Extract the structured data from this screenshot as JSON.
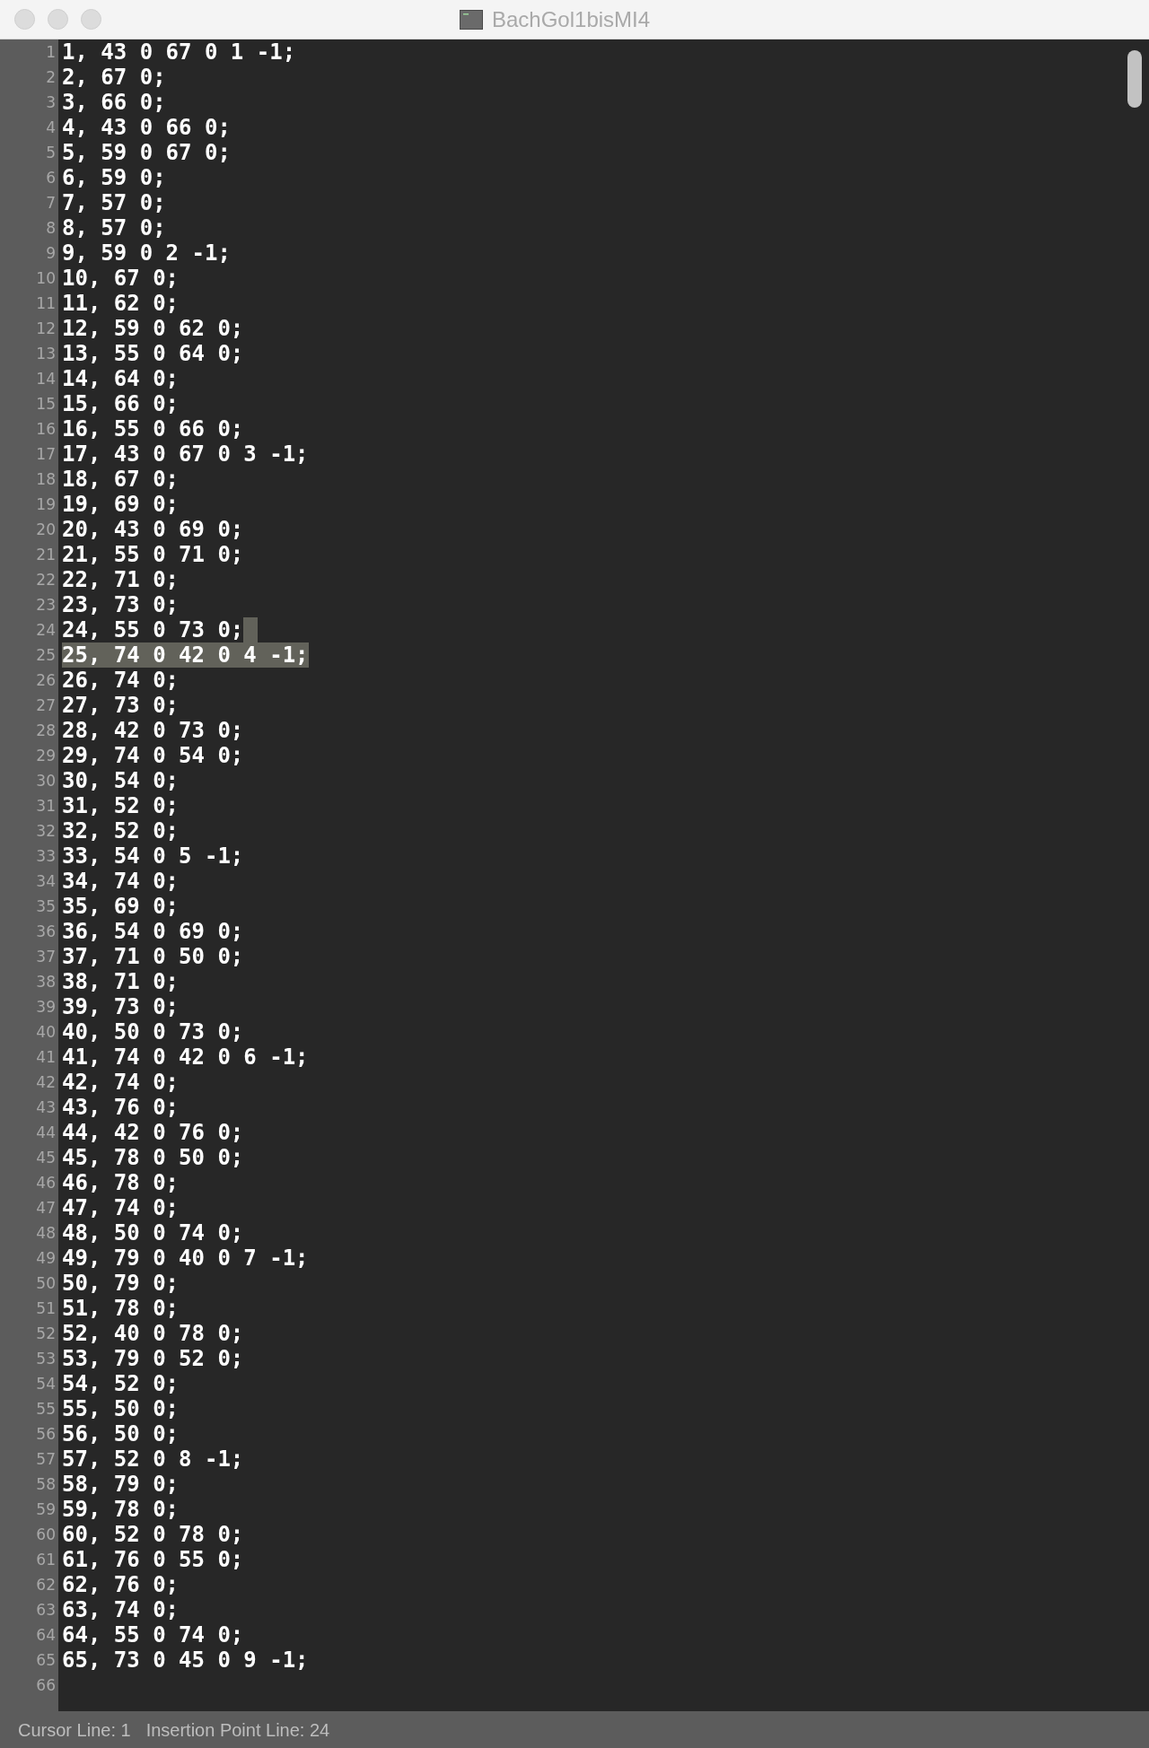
{
  "window": {
    "title": "BachGol1bisMI4"
  },
  "lines": [
    {
      "number": "1",
      "text": "1, 43 0 67 0 1 -1;",
      "selected": false,
      "caret": false
    },
    {
      "number": "2",
      "text": "2, 67 0;",
      "selected": false,
      "caret": false
    },
    {
      "number": "3",
      "text": "3, 66 0;",
      "selected": false,
      "caret": false
    },
    {
      "number": "4",
      "text": "4, 43 0 66 0;",
      "selected": false,
      "caret": false
    },
    {
      "number": "5",
      "text": "5, 59 0 67 0;",
      "selected": false,
      "caret": false
    },
    {
      "number": "6",
      "text": "6, 59 0;",
      "selected": false,
      "caret": false
    },
    {
      "number": "7",
      "text": "7, 57 0;",
      "selected": false,
      "caret": false
    },
    {
      "number": "8",
      "text": "8, 57 0;",
      "selected": false,
      "caret": false
    },
    {
      "number": "9",
      "text": "9, 59 0 2 -1;",
      "selected": false,
      "caret": false
    },
    {
      "number": "10",
      "text": "10, 67 0;",
      "selected": false,
      "caret": false
    },
    {
      "number": "11",
      "text": "11, 62 0;",
      "selected": false,
      "caret": false
    },
    {
      "number": "12",
      "text": "12, 59 0 62 0;",
      "selected": false,
      "caret": false
    },
    {
      "number": "13",
      "text": "13, 55 0 64 0;",
      "selected": false,
      "caret": false
    },
    {
      "number": "14",
      "text": "14, 64 0;",
      "selected": false,
      "caret": false
    },
    {
      "number": "15",
      "text": "15, 66 0;",
      "selected": false,
      "caret": false
    },
    {
      "number": "16",
      "text": "16, 55 0 66 0;",
      "selected": false,
      "caret": false
    },
    {
      "number": "17",
      "text": "17, 43 0 67 0 3 -1;",
      "selected": false,
      "caret": false
    },
    {
      "number": "18",
      "text": "18, 67 0;",
      "selected": false,
      "caret": false
    },
    {
      "number": "19",
      "text": "19, 69 0;",
      "selected": false,
      "caret": false
    },
    {
      "number": "20",
      "text": "20, 43 0 69 0;",
      "selected": false,
      "caret": false
    },
    {
      "number": "21",
      "text": "21, 55 0 71 0;",
      "selected": false,
      "caret": false
    },
    {
      "number": "22",
      "text": "22, 71 0;",
      "selected": false,
      "caret": false
    },
    {
      "number": "23",
      "text": "23, 73 0;",
      "selected": false,
      "caret": false
    },
    {
      "number": "24",
      "text": "24, 55 0 73 0;",
      "selected": false,
      "caret": true
    },
    {
      "number": "25",
      "text": "25, 74 0 42 0 4 -1;",
      "selected": true,
      "caret": false
    },
    {
      "number": "26",
      "text": "26, 74 0;",
      "selected": false,
      "caret": false
    },
    {
      "number": "27",
      "text": "27, 73 0;",
      "selected": false,
      "caret": false
    },
    {
      "number": "28",
      "text": "28, 42 0 73 0;",
      "selected": false,
      "caret": false
    },
    {
      "number": "29",
      "text": "29, 74 0 54 0;",
      "selected": false,
      "caret": false
    },
    {
      "number": "30",
      "text": "30, 54 0;",
      "selected": false,
      "caret": false
    },
    {
      "number": "31",
      "text": "31, 52 0;",
      "selected": false,
      "caret": false
    },
    {
      "number": "32",
      "text": "32, 52 0;",
      "selected": false,
      "caret": false
    },
    {
      "number": "33",
      "text": "33, 54 0 5 -1;",
      "selected": false,
      "caret": false
    },
    {
      "number": "34",
      "text": "34, 74 0;",
      "selected": false,
      "caret": false
    },
    {
      "number": "35",
      "text": "35, 69 0;",
      "selected": false,
      "caret": false
    },
    {
      "number": "36",
      "text": "36, 54 0 69 0;",
      "selected": false,
      "caret": false
    },
    {
      "number": "37",
      "text": "37, 71 0 50 0;",
      "selected": false,
      "caret": false
    },
    {
      "number": "38",
      "text": "38, 71 0;",
      "selected": false,
      "caret": false
    },
    {
      "number": "39",
      "text": "39, 73 0;",
      "selected": false,
      "caret": false
    },
    {
      "number": "40",
      "text": "40, 50 0 73 0;",
      "selected": false,
      "caret": false
    },
    {
      "number": "41",
      "text": "41, 74 0 42 0 6 -1;",
      "selected": false,
      "caret": false
    },
    {
      "number": "42",
      "text": "42, 74 0;",
      "selected": false,
      "caret": false
    },
    {
      "number": "43",
      "text": "43, 76 0;",
      "selected": false,
      "caret": false
    },
    {
      "number": "44",
      "text": "44, 42 0 76 0;",
      "selected": false,
      "caret": false
    },
    {
      "number": "45",
      "text": "45, 78 0 50 0;",
      "selected": false,
      "caret": false
    },
    {
      "number": "46",
      "text": "46, 78 0;",
      "selected": false,
      "caret": false
    },
    {
      "number": "47",
      "text": "47, 74 0;",
      "selected": false,
      "caret": false
    },
    {
      "number": "48",
      "text": "48, 50 0 74 0;",
      "selected": false,
      "caret": false
    },
    {
      "number": "49",
      "text": "49, 79 0 40 0 7 -1;",
      "selected": false,
      "caret": false
    },
    {
      "number": "50",
      "text": "50, 79 0;",
      "selected": false,
      "caret": false
    },
    {
      "number": "51",
      "text": "51, 78 0;",
      "selected": false,
      "caret": false
    },
    {
      "number": "52",
      "text": "52, 40 0 78 0;",
      "selected": false,
      "caret": false
    },
    {
      "number": "53",
      "text": "53, 79 0 52 0;",
      "selected": false,
      "caret": false
    },
    {
      "number": "54",
      "text": "54, 52 0;",
      "selected": false,
      "caret": false
    },
    {
      "number": "55",
      "text": "55, 50 0;",
      "selected": false,
      "caret": false
    },
    {
      "number": "56",
      "text": "56, 50 0;",
      "selected": false,
      "caret": false
    },
    {
      "number": "57",
      "text": "57, 52 0 8 -1;",
      "selected": false,
      "caret": false
    },
    {
      "number": "58",
      "text": "58, 79 0;",
      "selected": false,
      "caret": false
    },
    {
      "number": "59",
      "text": "59, 78 0;",
      "selected": false,
      "caret": false
    },
    {
      "number": "60",
      "text": "60, 52 0 78 0;",
      "selected": false,
      "caret": false
    },
    {
      "number": "61",
      "text": "61, 76 0 55 0;",
      "selected": false,
      "caret": false
    },
    {
      "number": "62",
      "text": "62, 76 0;",
      "selected": false,
      "caret": false
    },
    {
      "number": "63",
      "text": "63, 74 0;",
      "selected": false,
      "caret": false
    },
    {
      "number": "64",
      "text": "64, 55 0 74 0;",
      "selected": false,
      "caret": false
    },
    {
      "number": "65",
      "text": "65, 73 0 45 0 9 -1;",
      "selected": false,
      "caret": false
    },
    {
      "number": "66"
    }
  ],
  "status_bar": {
    "cursor_line": "Cursor Line: 1",
    "insertion_point_line": "Insertion Point Line: 24"
  }
}
